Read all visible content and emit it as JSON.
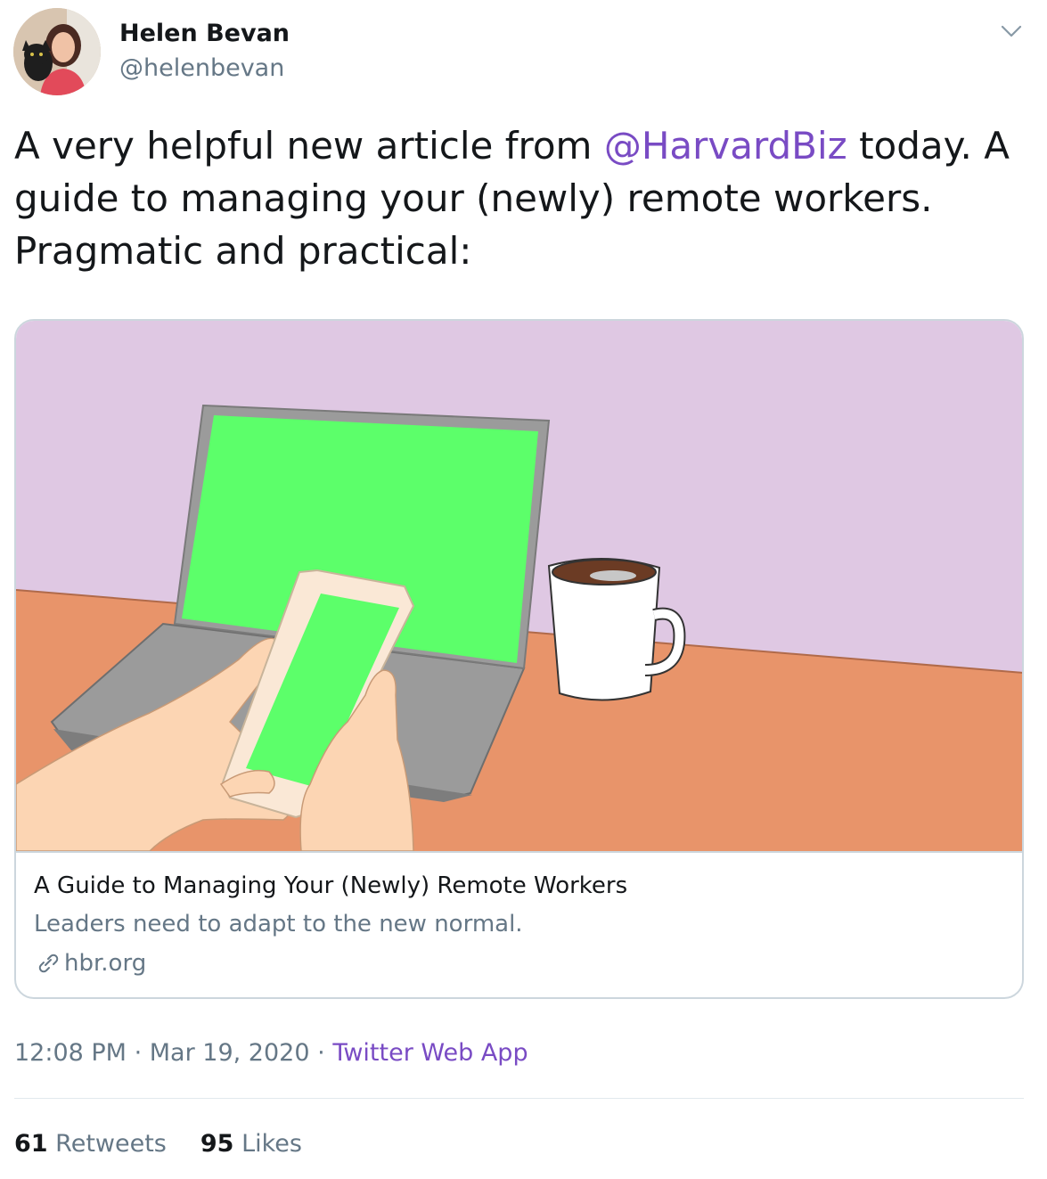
{
  "author": {
    "name": "Helen Bevan",
    "handle": "@helenbevan"
  },
  "tweet": {
    "text_before": "A very helpful new article from ",
    "mention": "@HarvardBiz",
    "text_after": " today. A guide to managing your (newly) remote workers. Pragmatic and practical:"
  },
  "card": {
    "title": "A Guide to Managing Your (Newly) Remote Workers",
    "description": "Leaders need to adapt to the new normal.",
    "domain": "hbr.org",
    "domain_icon": "link-icon"
  },
  "meta": {
    "time": "12:08 PM",
    "separator": "·",
    "date": "Mar 19, 2020",
    "app": "Twitter Web App"
  },
  "stats": {
    "retweets_count": "61",
    "retweets_label": "Retweets",
    "likes_count": "95",
    "likes_label": "Likes"
  },
  "colors": {
    "accent": "#794bc4",
    "secondary_text": "#657786",
    "border": "#ccd6dd",
    "wall": "#dfc8e3",
    "desk": "#e8946a",
    "screen": "#5cff6a"
  }
}
